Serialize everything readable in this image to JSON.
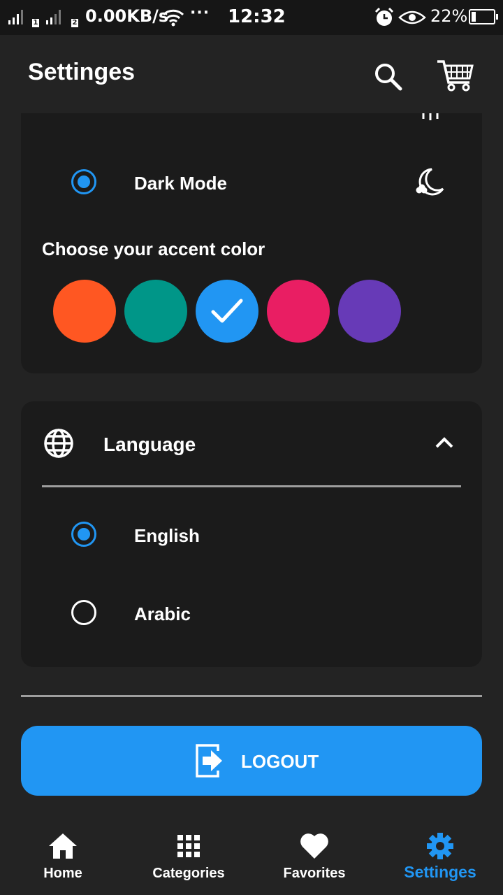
{
  "status_bar": {
    "sim1": "1",
    "sim2": "2",
    "net_speed": "0.00KB/s",
    "more": "···",
    "time": "12:32",
    "battery": "22%"
  },
  "app_bar": {
    "title": "Settinges",
    "search_icon": "search-icon",
    "cart_icon": "cart-icon"
  },
  "theme_card": {
    "partial_option_icon": "sun-icon",
    "dark_mode": {
      "label": "Dark Mode",
      "selected": true,
      "icon": "moon-icon"
    },
    "accent_heading": "Choose your accent color",
    "accent_colors": [
      {
        "hex": "#ff5722",
        "selected": false
      },
      {
        "hex": "#009688",
        "selected": false
      },
      {
        "hex": "#2196f3",
        "selected": true
      },
      {
        "hex": "#e91e63",
        "selected": false
      },
      {
        "hex": "#673ab7",
        "selected": false
      }
    ]
  },
  "language_card": {
    "title": "Language",
    "icon": "globe-icon",
    "expanded": true,
    "options": [
      {
        "label": "English",
        "selected": true
      },
      {
        "label": "Arabic",
        "selected": false
      }
    ]
  },
  "logout": {
    "label": "LOGOUT",
    "icon": "logout-icon"
  },
  "bottom_nav": [
    {
      "label": "Home",
      "icon": "home-icon",
      "active": false
    },
    {
      "label": "Categories",
      "icon": "grid-icon",
      "active": false
    },
    {
      "label": "Favorites",
      "icon": "heart-icon",
      "active": false
    },
    {
      "label": "Settinges",
      "icon": "gear-icon",
      "active": true
    }
  ],
  "colors": {
    "accent": "#2196f3",
    "background": "#232323",
    "card": "#1b1b1b",
    "status_bar": "#161616"
  }
}
